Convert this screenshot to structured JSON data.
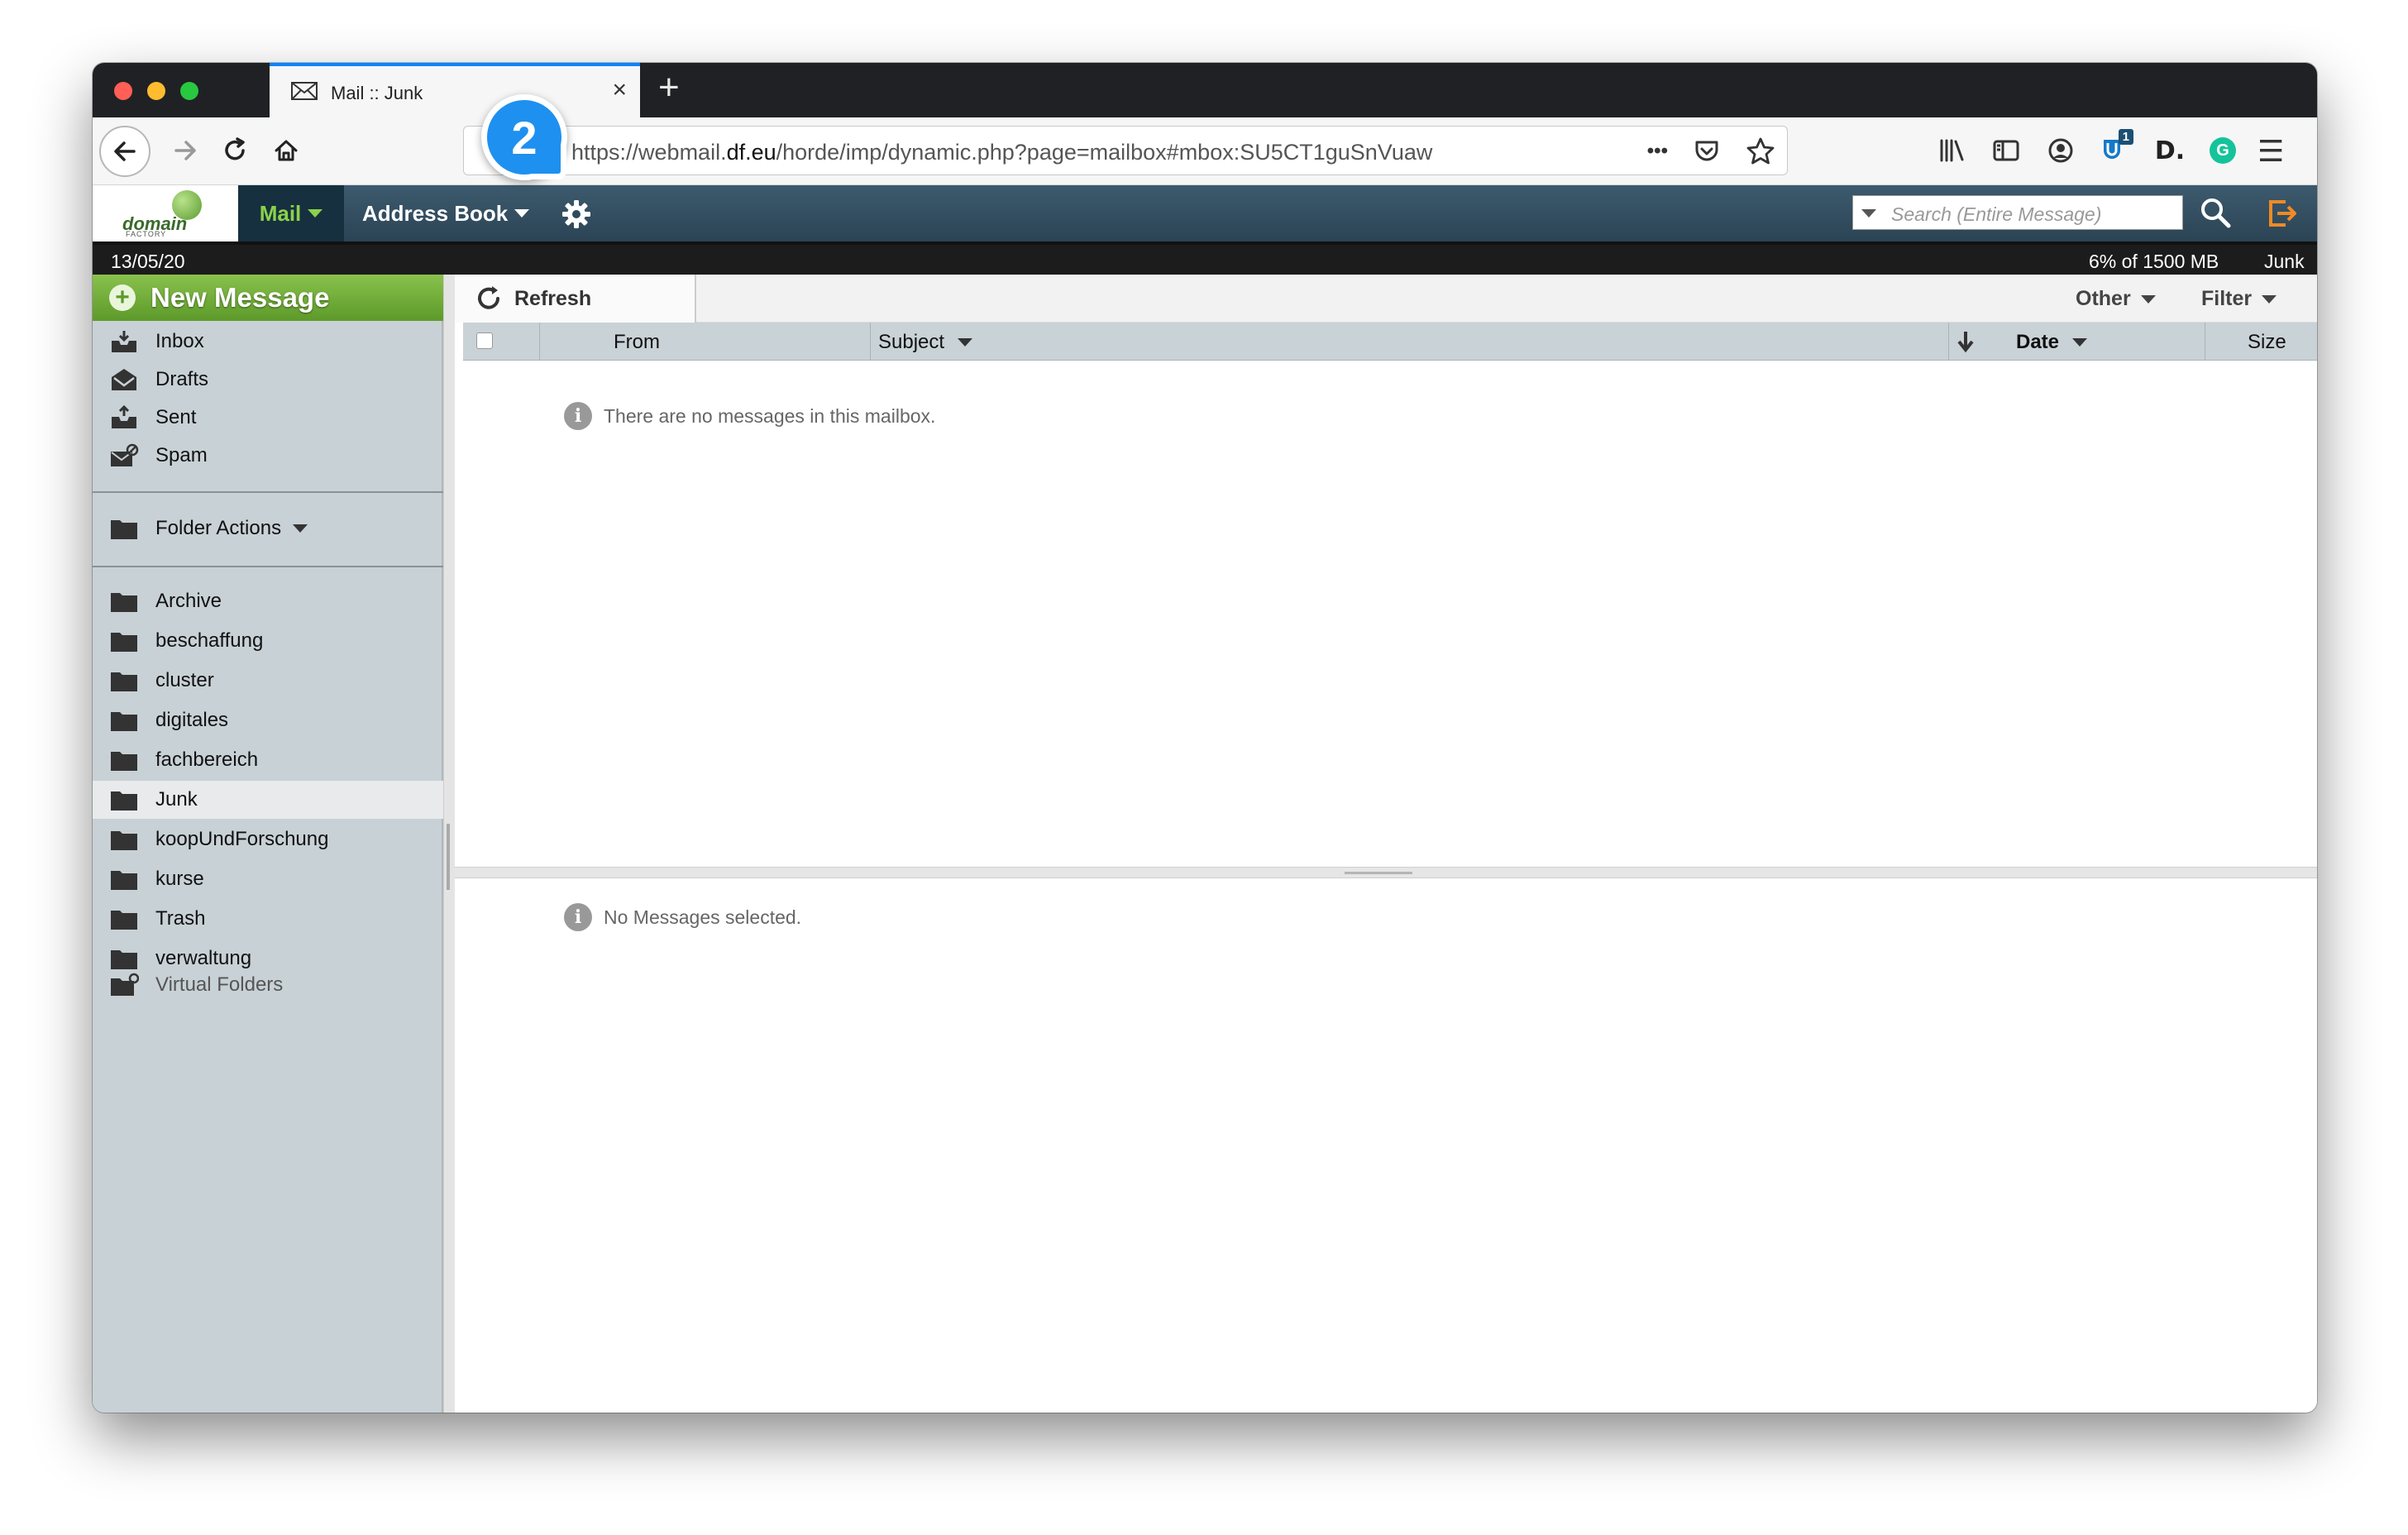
{
  "browser": {
    "tab_title": "Mail :: Junk",
    "tab_close": "×",
    "new_tab": "+",
    "url_prefix": "https://webmail.",
    "url_domain": "df.eu",
    "url_path": "/horde/imp/dynamic.php?page=mailbox#mbox:SU5CT1guSnVuaw",
    "url_more": "•••",
    "ext_badge": "1",
    "ext_d": "D.",
    "ext_g": "G",
    "menu_glyph": "☰"
  },
  "callout": {
    "number": "2"
  },
  "horde": {
    "logo_text": "domain",
    "logo_sub": "FACTORY",
    "menu_mail": "Mail",
    "menu_addressbook": "Address Book",
    "search_placeholder": "Search (Entire Message)"
  },
  "status": {
    "date": "13/05/20",
    "quota": "6% of 1500 MB",
    "mailbox": "Junk"
  },
  "sidebar": {
    "new_message": "New Message",
    "special_folders": [
      {
        "label": "Inbox",
        "icon": "inbox-icon"
      },
      {
        "label": "Drafts",
        "icon": "drafts-icon"
      },
      {
        "label": "Sent",
        "icon": "sent-icon"
      },
      {
        "label": "Spam",
        "icon": "spam-icon"
      }
    ],
    "folder_actions": "Folder Actions",
    "folders": [
      "Archive",
      "beschaffung",
      "cluster",
      "digitales",
      "fachbereich",
      "Junk",
      "koopUndForschung",
      "kurse",
      "Trash",
      "verwaltung"
    ],
    "active_folder": "Junk",
    "virtual_folders": "Virtual Folders"
  },
  "toolbar": {
    "refresh": "Refresh",
    "other": "Other",
    "filter": "Filter"
  },
  "columns": {
    "from": "From",
    "subject": "Subject",
    "date": "Date",
    "size": "Size"
  },
  "messages": {
    "empty_text": "There are no messages in this mailbox.",
    "preview_text": "No Messages selected.",
    "info_glyph": "i"
  },
  "colors": {
    "accent": "#0a84ff",
    "horde_bar": "#2f4a5c",
    "new_message_green": "#6faa35",
    "sidebar_bg": "#c8d1d6",
    "callout_blue": "#1e90f0",
    "logout_orange": "#f08a24"
  }
}
